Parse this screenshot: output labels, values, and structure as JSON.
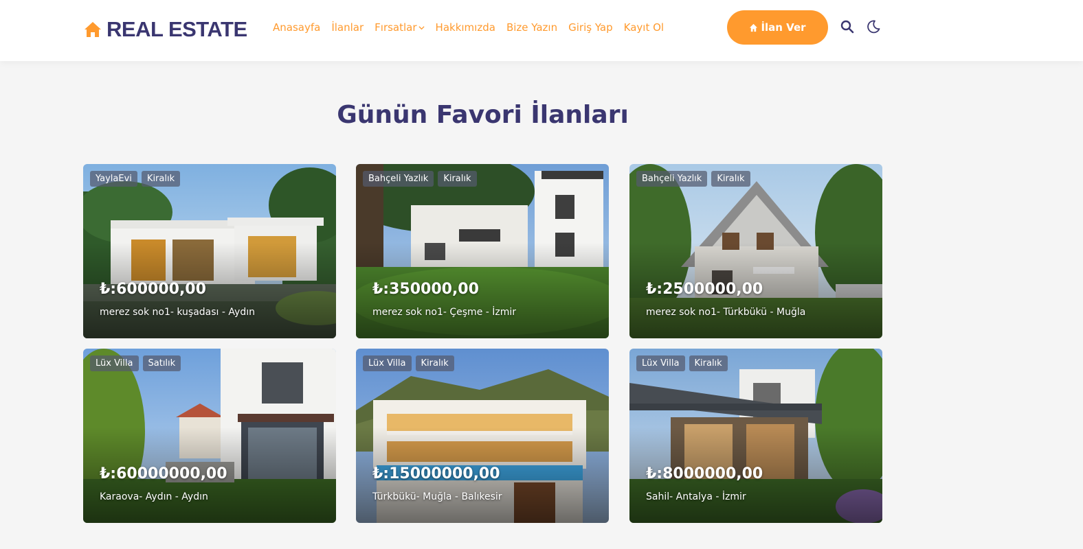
{
  "brand": {
    "name": "REAL ESTATE",
    "icon": "home-icon",
    "color": "#3a3670",
    "accent": "#ff9a2e"
  },
  "nav": [
    {
      "label": "Anasayfa"
    },
    {
      "label": "İlanlar"
    },
    {
      "label": "Fırsatlar",
      "dropdown": true
    },
    {
      "label": "Hakkımızda"
    },
    {
      "label": "Bize Yazın"
    },
    {
      "label": "Giriş Yap"
    },
    {
      "label": "Kayıt Ol"
    }
  ],
  "cta": {
    "label": "İlan Ver",
    "icon": "home-icon"
  },
  "header_icons": {
    "search": "search-icon",
    "theme": "moon-icon"
  },
  "section": {
    "title": "Günün Favori İlanları"
  },
  "listings": [
    {
      "tags": [
        "YaylaEvi",
        "Kiralık"
      ],
      "price": "₺:600000,00",
      "location": "merez sok no1- kuşadası - Aydın",
      "scene": "modern-bungalow"
    },
    {
      "tags": [
        "Bahçeli Yazlık",
        "Kiralık"
      ],
      "price": "₺:350000,00",
      "location": "merez sok no1- Çeşme - İzmir",
      "scene": "garden-villas"
    },
    {
      "tags": [
        "Bahçeli Yazlık",
        "Kiralık"
      ],
      "price": "₺:2500000,00",
      "location": "merez sok no1- Türkbükü - Muğla",
      "scene": "chalet-house"
    },
    {
      "tags": [
        "Lüx Villa",
        "Satılık"
      ],
      "price": "₺:60000000,00",
      "location": "Karaova- Aydın - Aydın",
      "scene": "white-villa"
    },
    {
      "tags": [
        "Lüx Villa",
        "Kiralık"
      ],
      "price": "₺:15000000,00",
      "location": "Türkbükü- Muğla - Balıkesir",
      "scene": "pool-villa"
    },
    {
      "tags": [
        "Lüx Villa",
        "Kiralık"
      ],
      "price": "₺:8000000,00",
      "location": "Sahil- Antalya - İzmir",
      "scene": "modern-garden-house"
    }
  ]
}
